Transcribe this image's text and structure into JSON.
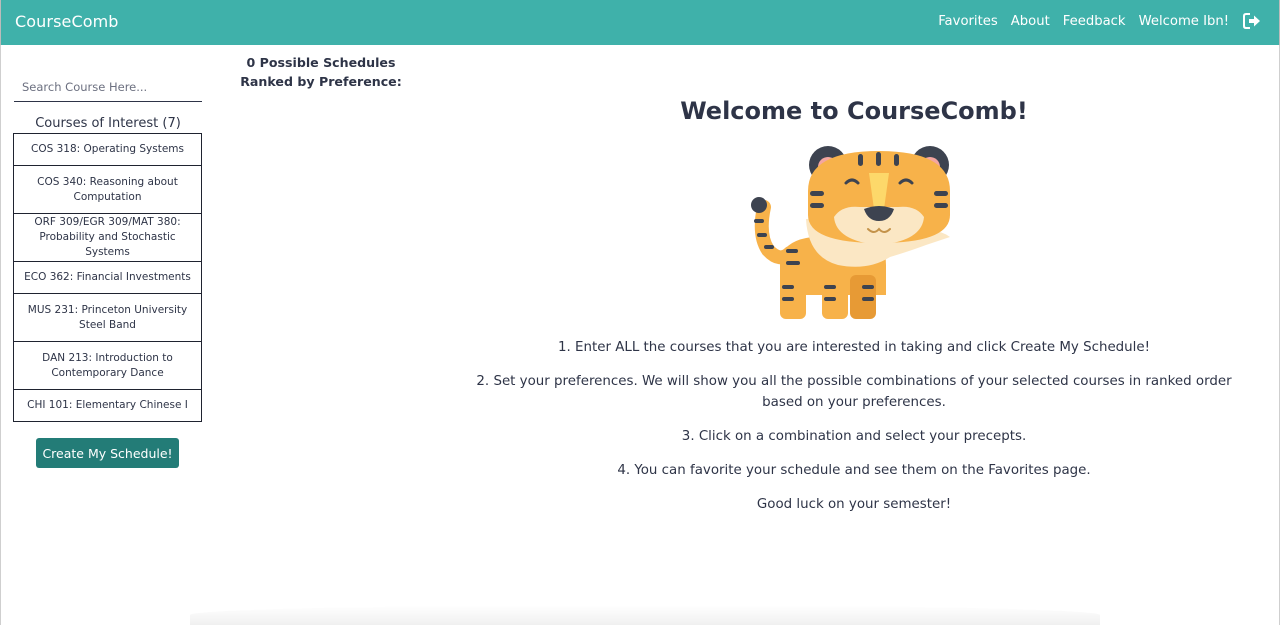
{
  "navbar": {
    "brand": "CourseComb",
    "links": [
      "Favorites",
      "About",
      "Feedback",
      "Welcome Ibn!"
    ],
    "logout_icon": "logout-icon",
    "background_color": "#3fb1aa"
  },
  "sidebar": {
    "search_placeholder": "Search Course Here...",
    "interest_title": "Courses of Interest (7)",
    "courses": [
      "COS 318: Operating Systems",
      "COS 340: Reasoning about Computation",
      "ORF 309/EGR 309/MAT 380: Probability and Stochastic Systems",
      "ECO 362: Financial Investments",
      "MUS 231: Princeton University Steel Band",
      "DAN 213: Introduction to Contemporary Dance",
      "CHI 101: Elementary Chinese I"
    ],
    "create_button": "Create My Schedule!",
    "button_color": "#237c77"
  },
  "schedules": {
    "count_text": "0 Possible Schedules Ranked by Preference:"
  },
  "main": {
    "welcome_title": "Welcome to CourseComb!",
    "mascot_icon": "tiger-illustration",
    "instructions": [
      "1. Enter ALL the courses that you are interested in taking and click Create My Schedule!",
      "2. Set your preferences. We will show you all the possible combinations of your selected courses in ranked order based on your preferences.",
      "3. Click on a combination and select your precepts.",
      "4. You can favorite your schedule and see them on the Favorites page.",
      "Good luck on your semester!"
    ]
  }
}
